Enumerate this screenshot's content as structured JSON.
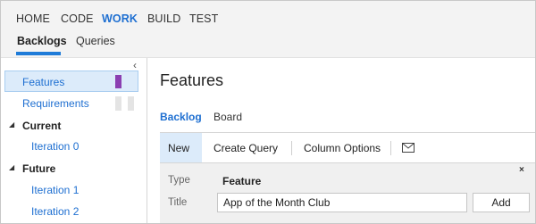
{
  "top_nav": {
    "items": [
      "HOME",
      "CODE",
      "WORK",
      "BUILD",
      "TEST"
    ],
    "active": "WORK"
  },
  "sub_nav": {
    "items": [
      "Backlogs",
      "Queries"
    ],
    "active": "Backlogs"
  },
  "sidebar": {
    "backlogs": [
      {
        "label": "Features",
        "selected": true,
        "bar_color": "#8b3fb1"
      },
      {
        "label": "Requirements",
        "selected": false,
        "bar_color": "#e4e4e4"
      }
    ],
    "groups": [
      {
        "label": "Current",
        "iterations": [
          "Iteration 0"
        ]
      },
      {
        "label": "Future",
        "iterations": [
          "Iteration 1",
          "Iteration 2"
        ]
      }
    ]
  },
  "main": {
    "title": "Features",
    "tabs": [
      "Backlog",
      "Board"
    ],
    "active_tab": "Backlog",
    "toolbar": {
      "new_label": "New",
      "create_query_label": "Create Query",
      "column_options_label": "Column Options",
      "mail_icon": "mail-icon"
    },
    "new_item_form": {
      "type_label": "Type",
      "type_value": "Feature",
      "title_label": "Title",
      "title_value": "App of the Month Club",
      "add_label": "Add",
      "close_label": "×"
    }
  },
  "colors": {
    "accent": "#1e6fd1",
    "selected_bg": "#dcebfa",
    "feature_bar": "#8b3fb1"
  }
}
